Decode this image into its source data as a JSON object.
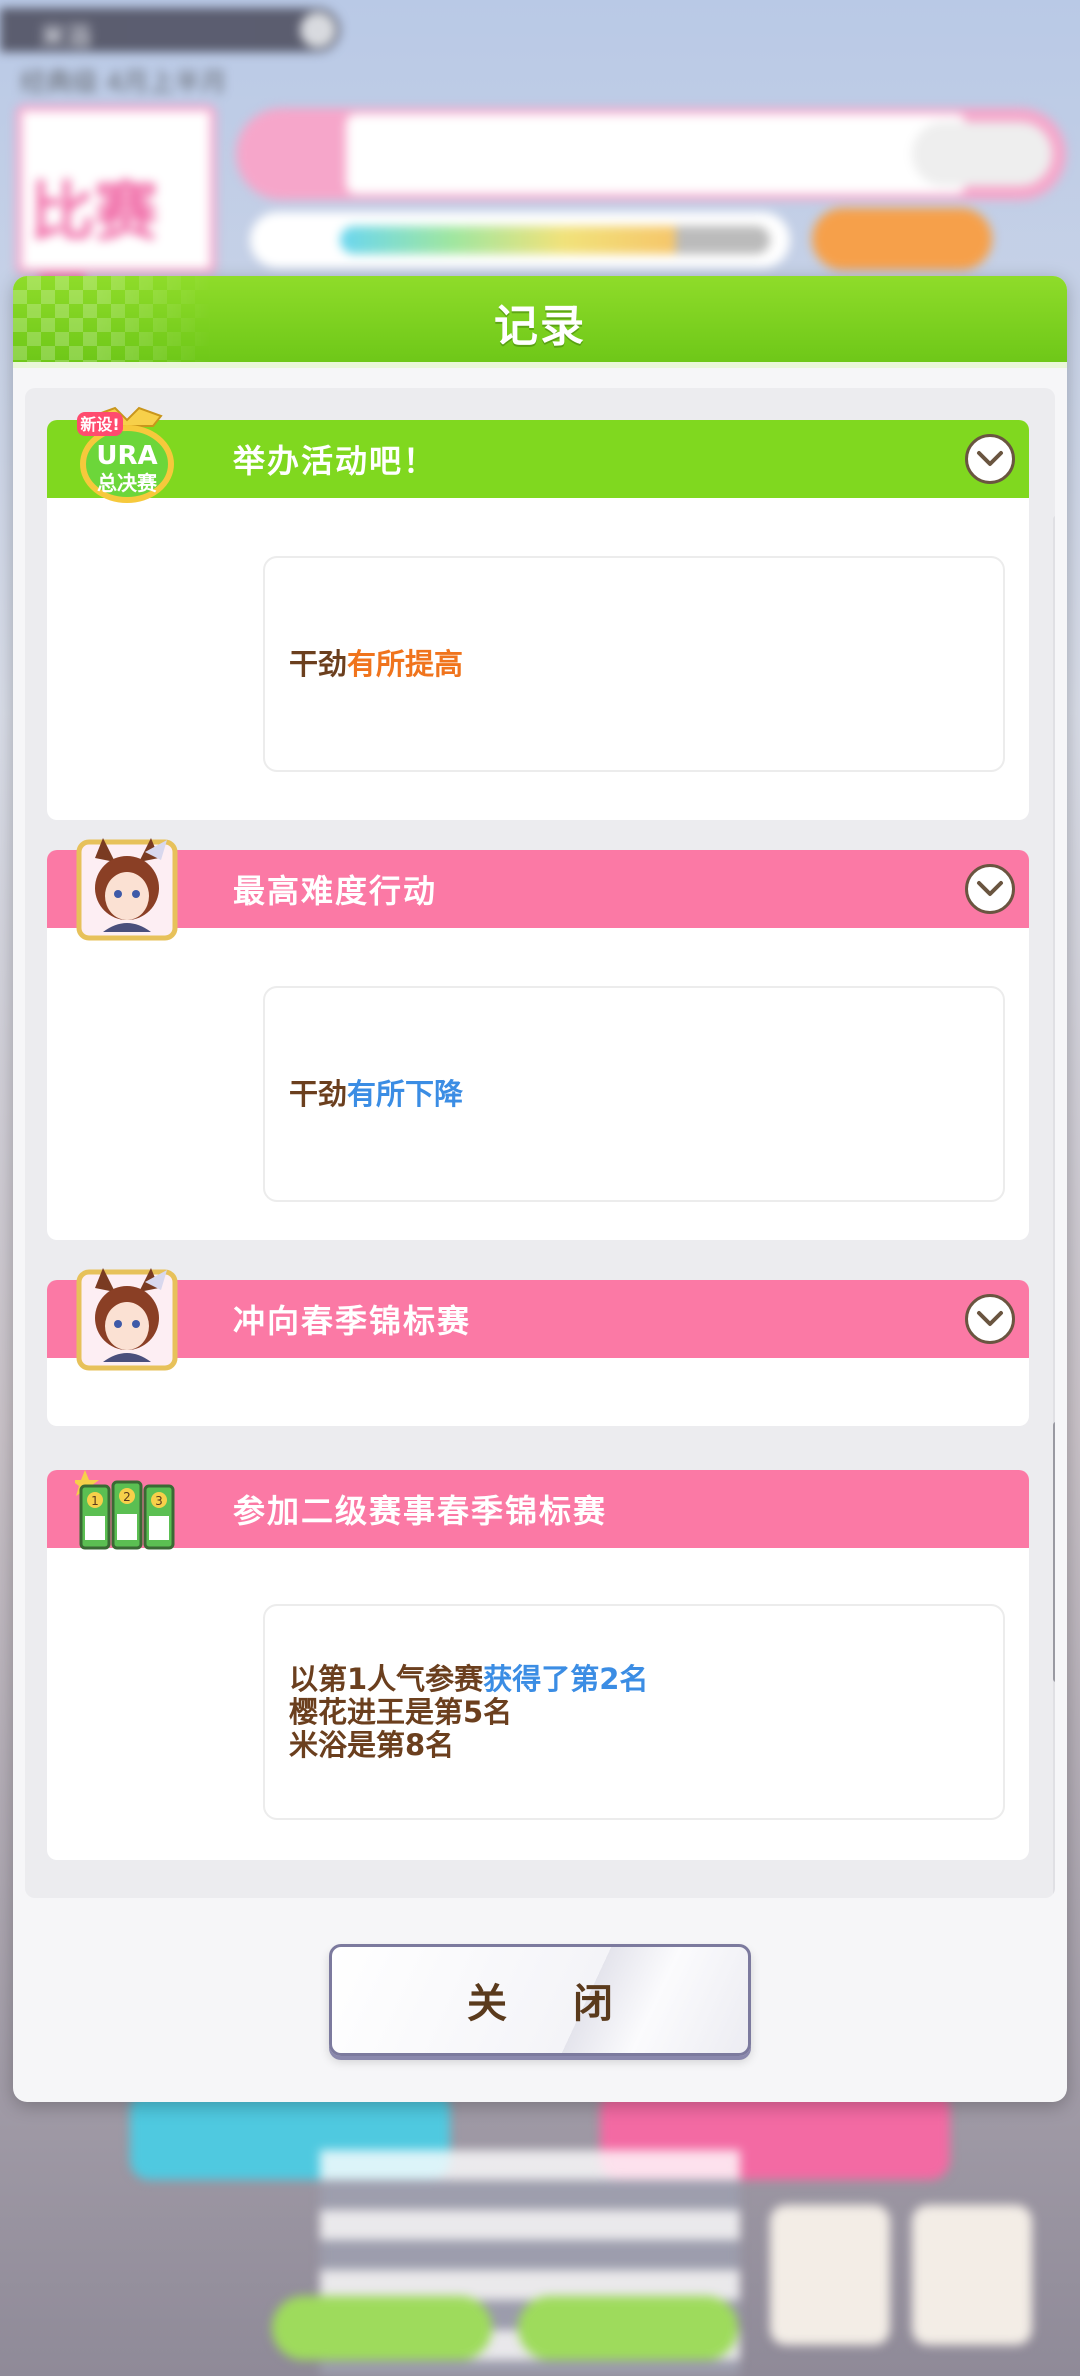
{
  "dialog": {
    "title": "记录",
    "close_label": "关 闭"
  },
  "entries": [
    {
      "title": "举办活动吧！",
      "icon": "ura-finals-badge-icon",
      "icon_text_top": "新设!",
      "icon_text_mid": "URA",
      "icon_text_bottom": "总决赛",
      "bar_color": "#80d81f",
      "detail": {
        "prefix": "干劲",
        "highlight": "有所提高",
        "highlight_color": "#f0741d"
      }
    },
    {
      "title": "最高难度行动",
      "icon": "character-portrait-icon",
      "bar_color": "#fb79a5",
      "detail": {
        "prefix": "干劲",
        "highlight": "有所下降",
        "highlight_color": "#3b8de4"
      }
    },
    {
      "title": "冲向春季锦标赛",
      "icon": "character-portrait-icon",
      "bar_color": "#fb79a5"
    },
    {
      "title": "参加二级赛事春季锦标赛",
      "icon": "race-ranking-cards-icon",
      "bar_color": "#fb79a5",
      "detail": {
        "line1_prefix": "以第1人气参赛",
        "line1_highlight": "获得了第2名",
        "line2": "樱花进王是第5名",
        "line3": "米浴是第8名"
      }
    }
  ],
  "background": {
    "calendar_text": "比赛日",
    "colors": {
      "accent_green": "#80d81f",
      "accent_pink": "#fb79a5",
      "text_brown": "#6b3f1e"
    }
  }
}
